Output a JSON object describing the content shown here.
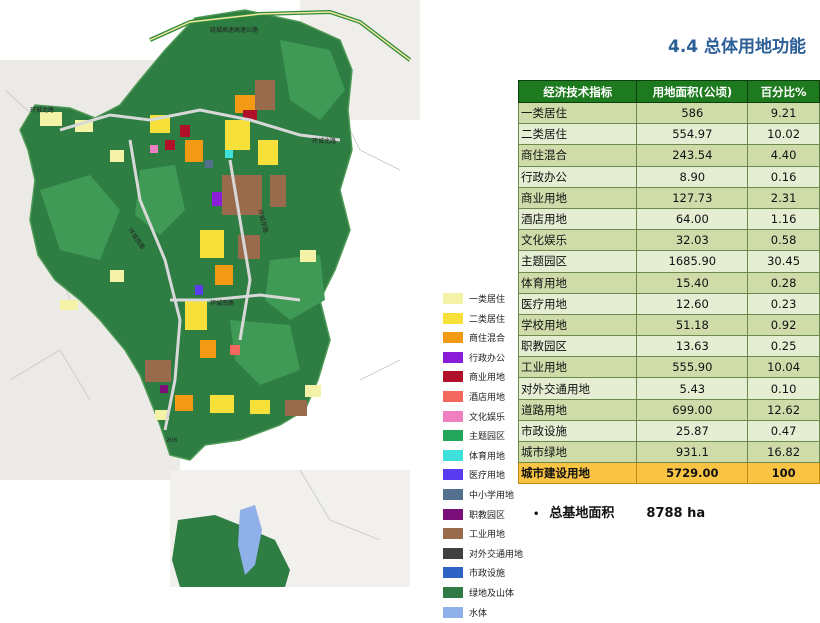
{
  "title": "4.4 总体用地功能",
  "map_labels": {
    "expressway": "绕城高速高速公路",
    "north_ring": "环城北路",
    "north_ring_2": "环城北路",
    "west_ring": "环城西路",
    "east_ring": "环城东路",
    "south_ring": "环城南路",
    "highway": "206"
  },
  "legend": [
    {
      "label": "一类居住",
      "color": "#f4f2a6"
    },
    {
      "label": "二类居住",
      "color": "#f7e03a"
    },
    {
      "label": "商住混合",
      "color": "#f39a14"
    },
    {
      "label": "行政办公",
      "color": "#8a1ed8"
    },
    {
      "label": "商业用地",
      "color": "#b0102a"
    },
    {
      "label": "酒店用地",
      "color": "#f2685e"
    },
    {
      "label": "文化娱乐",
      "color": "#ef80c0"
    },
    {
      "label": "主题园区",
      "color": "#23a55a"
    },
    {
      "label": "体育用地",
      "color": "#3ee0dc"
    },
    {
      "label": "医疗用地",
      "color": "#5a3cf0"
    },
    {
      "label": "中小学用地",
      "color": "#53708f"
    },
    {
      "label": "职教园区",
      "color": "#7a0f7a"
    },
    {
      "label": "工业用地",
      "color": "#9a6a4c"
    },
    {
      "label": "对外交通用地",
      "color": "#404040"
    },
    {
      "label": "市政设施",
      "color": "#2f64c6"
    },
    {
      "label": "绿地及山体",
      "color": "#2f7a45"
    },
    {
      "label": "水体",
      "color": "#8fb0e8"
    }
  ],
  "table": {
    "headers": [
      "经济技术指标",
      "用地面积(公顷)",
      "百分比%"
    ],
    "rows": [
      {
        "name": "一类居住",
        "area": "586",
        "pct": "9.21"
      },
      {
        "name": "二类居住",
        "area": "554.97",
        "pct": "10.02"
      },
      {
        "name": "商住混合",
        "area": "243.54",
        "pct": "4.40"
      },
      {
        "name": "行政办公",
        "area": "8.90",
        "pct": "0.16"
      },
      {
        "name": "商业用地",
        "area": "127.73",
        "pct": "2.31"
      },
      {
        "name": "酒店用地",
        "area": "64.00",
        "pct": "1.16"
      },
      {
        "name": "文化娱乐",
        "area": "32.03",
        "pct": "0.58"
      },
      {
        "name": "主题园区",
        "area": "1685.90",
        "pct": "30.45"
      },
      {
        "name": "体育用地",
        "area": "15.40",
        "pct": "0.28"
      },
      {
        "name": "医疗用地",
        "area": "12.60",
        "pct": "0.23"
      },
      {
        "name": "学校用地",
        "area": "51.18",
        "pct": "0.92"
      },
      {
        "name": "职教园区",
        "area": "13.63",
        "pct": "0.25"
      },
      {
        "name": "工业用地",
        "area": "555.90",
        "pct": "10.04"
      },
      {
        "name": "对外交通用地",
        "area": "5.43",
        "pct": "0.10"
      },
      {
        "name": "道路用地",
        "area": "699.00",
        "pct": "12.62"
      },
      {
        "name": "市政设施",
        "area": "25.87",
        "pct": "0.47"
      },
      {
        "name": "城市绿地",
        "area": "931.1",
        "pct": "16.82"
      }
    ],
    "total": {
      "name": "城市建设用地",
      "area": "5729.00",
      "pct": "100"
    }
  },
  "summary": {
    "label": "总基地面积",
    "value": "8788 ha"
  }
}
